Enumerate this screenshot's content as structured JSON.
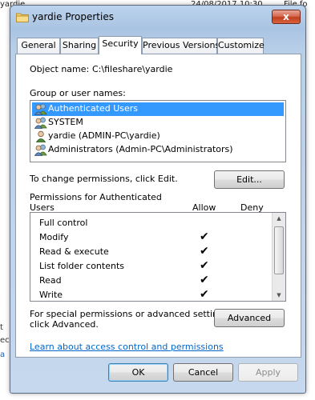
{
  "background": {
    "top_left_text": "yardie",
    "top_mid_text": "24/08/2017 10:30",
    "top_right_text": "File fo",
    "left_fragments": [
      {
        "text": "t",
        "color": "#333333"
      },
      {
        "text": "ec",
        "color": "#333333"
      },
      {
        "text": "a",
        "color": "#1a5fb4"
      }
    ]
  },
  "window": {
    "title": "yardie Properties",
    "close_glyph": "x"
  },
  "tabs": [
    {
      "label": "General",
      "active": false
    },
    {
      "label": "Sharing",
      "active": false
    },
    {
      "label": "Security",
      "active": true
    },
    {
      "label": "Previous Versions",
      "active": false
    },
    {
      "label": "Customize",
      "active": false
    }
  ],
  "object": {
    "label": "Object name:",
    "value": "C:\\fileshare\\yardie"
  },
  "groups": {
    "label": "Group or user names:",
    "items": [
      {
        "label": "Authenticated Users",
        "icon": "users-group-icon",
        "selected": true
      },
      {
        "label": "SYSTEM",
        "icon": "users-group-icon",
        "selected": false
      },
      {
        "label": "yardie (ADMIN-PC\\yardie)",
        "icon": "user-icon",
        "selected": false
      },
      {
        "label": "Administrators (Admin-PC\\Administrators)",
        "icon": "users-group-icon",
        "selected": false
      }
    ]
  },
  "change_text": "To change permissions, click Edit.",
  "edit_button": "Edit...",
  "permissions": {
    "heading_line1": "Permissions for Authenticated",
    "heading_line2": "Users",
    "allow_header": "Allow",
    "deny_header": "Deny",
    "check_glyph": "✔",
    "items": [
      {
        "name": "Full control",
        "allow": false,
        "deny": false
      },
      {
        "name": "Modify",
        "allow": true,
        "deny": false
      },
      {
        "name": "Read & execute",
        "allow": true,
        "deny": false
      },
      {
        "name": "List folder contents",
        "allow": true,
        "deny": false
      },
      {
        "name": "Read",
        "allow": true,
        "deny": false
      },
      {
        "name": "Write",
        "allow": true,
        "deny": false
      }
    ]
  },
  "special": {
    "line1": "For special permissions or advanced settings,",
    "line2": "click Advanced.",
    "button": "Advanced"
  },
  "learn_link": "Learn about access control and permissions",
  "footer": {
    "ok": "OK",
    "cancel": "Cancel",
    "apply": "Apply"
  }
}
